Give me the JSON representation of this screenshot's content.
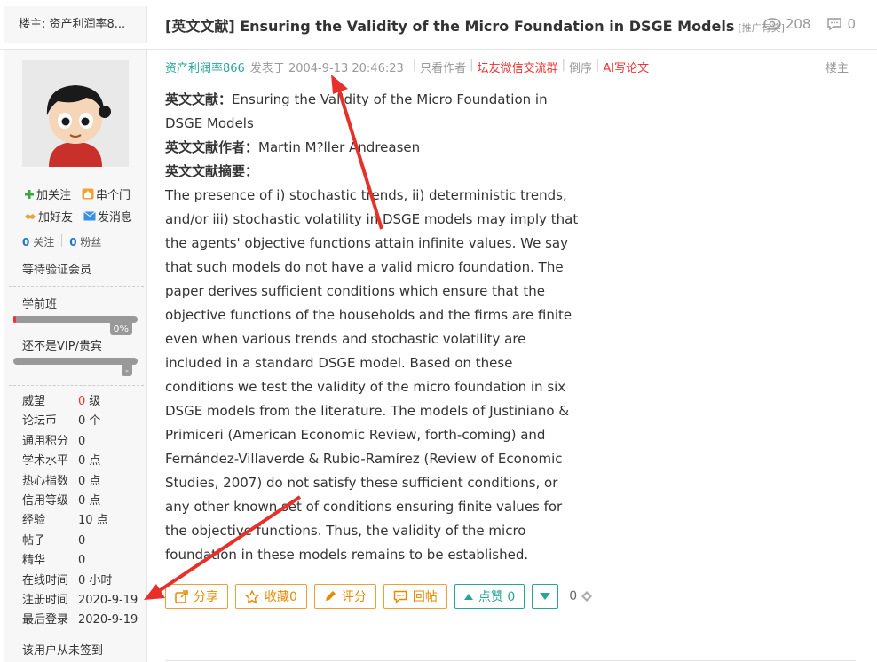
{
  "header": {
    "floor_owner": "楼主: 资产利润率8...",
    "title": "[英文文献] Ensuring the Validity of the Micro Foundation in DSGE Models",
    "tag": "[推广有奖]",
    "views": "208",
    "comments": "0"
  },
  "sidebar": {
    "follow": "加关注",
    "visit": "串个门",
    "add_friend": "加好友",
    "message": "发消息",
    "following_count": "0",
    "following_label": "关注",
    "fans_count": "0",
    "fans_label": "粉丝",
    "member_status": "等待验证会员",
    "level_name": "学前班",
    "level_progress_label": "0%",
    "level_progress": 0.02,
    "vip_name": "还不是VIP/贵宾",
    "vip_progress_label": "-",
    "stats": [
      {
        "key": "威望",
        "value": "0",
        "unit": "级"
      },
      {
        "key": "论坛币",
        "value": "0 个",
        "unit": ""
      },
      {
        "key": "通用积分",
        "value": "0",
        "unit": ""
      },
      {
        "key": "学术水平",
        "value": "0 点",
        "unit": ""
      },
      {
        "key": "热心指数",
        "value": "0 点",
        "unit": ""
      },
      {
        "key": "信用等级",
        "value": "0 点",
        "unit": ""
      },
      {
        "key": "经验",
        "value": "10 点",
        "unit": ""
      },
      {
        "key": "帖子",
        "value": "0",
        "unit": ""
      },
      {
        "key": "精华",
        "value": "0",
        "unit": ""
      },
      {
        "key": "在线时间",
        "value": "0 小时",
        "unit": ""
      },
      {
        "key": "注册时间",
        "value": "2020-9-19",
        "unit": ""
      },
      {
        "key": "最后登录",
        "value": "2020-9-19",
        "unit": ""
      }
    ],
    "no_sign": "该用户从未签到"
  },
  "post": {
    "author": "资产利润率866",
    "posted": "发表于 2004-9-13 20:46:23",
    "only_author": "只看作者",
    "wechat_group": "坛友微信交流群",
    "reverse": "倒序",
    "ai_write": "AI写论文",
    "floor": "楼主",
    "lit_label": "英文文献：",
    "lit_title": "Ensuring the Validity of the Micro Foundation in DSGE Models",
    "author_label": "英文文献作者：",
    "lit_author": "Martin M?ller Andreasen",
    "abstract_label": "英文文献摘要：",
    "abstract": "The presence of i) stochastic trends, ii) deterministic trends, and/or iii) stochastic volatility in DSGE models may imply that the agents' objective functions attain infinite values. We say that such models do not have a valid micro foundation. The paper derives sufficient conditions which ensure that the objective functions of the households and the firms are finite even when various trends and stochastic volatility are included in a standard DSGE model. Based on these conditions we test the validity of the micro foundation in six DSGE models from the literature. The models of Justiniano & Primiceri (American Economic Review, forth-coming) and Fernández-Villaverde & Rubio-Ramírez (Review of Economic Studies, 2007) do not satisfy these sufficient conditions, or any other known set of conditions ensuring finite values for the objective functions. Thus, the validity of the micro foundation in these models remains to be established."
  },
  "actions": {
    "share": "分享",
    "favorite": "收藏",
    "favorite_count": "0",
    "rate": "评分",
    "reply": "回帖",
    "like": "点赞",
    "like_count": "0",
    "score": "0"
  },
  "colors": {
    "accent_teal": "#26a69a",
    "accent_orange": "#e88a00",
    "red": "#e33",
    "arrow_red": "#e8302a"
  }
}
